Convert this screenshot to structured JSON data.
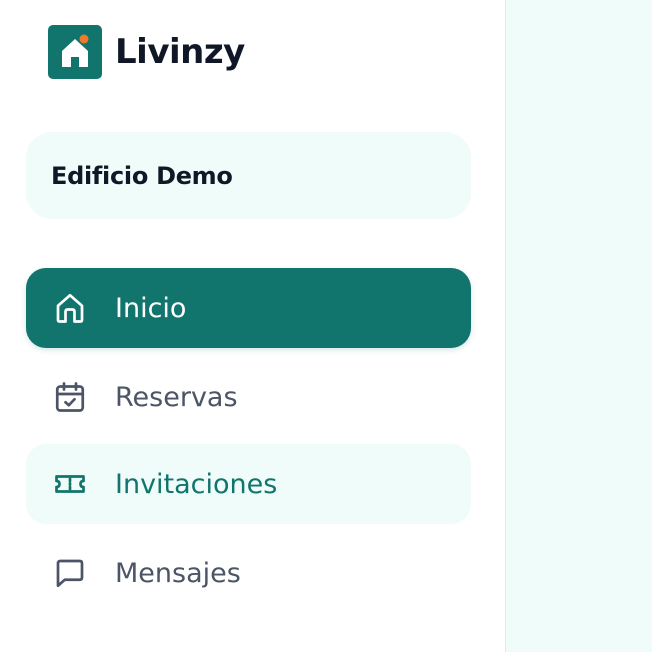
{
  "brand": {
    "name": "Livinzy",
    "accent_color": "#11756d",
    "dot_color": "#f07a2a"
  },
  "building": {
    "name": "Edificio Demo"
  },
  "nav": {
    "items": [
      {
        "label": "Inicio",
        "icon": "home-icon",
        "state": "active"
      },
      {
        "label": "Reservas",
        "icon": "calendar-check-icon",
        "state": "default"
      },
      {
        "label": "Invitaciones",
        "icon": "ticket-icon",
        "state": "hover"
      },
      {
        "label": "Mensajes",
        "icon": "message-square-icon",
        "state": "default"
      }
    ]
  },
  "colors": {
    "main_background": "#effcfa",
    "text_dark": "#101828",
    "text_muted": "#4b5565"
  }
}
